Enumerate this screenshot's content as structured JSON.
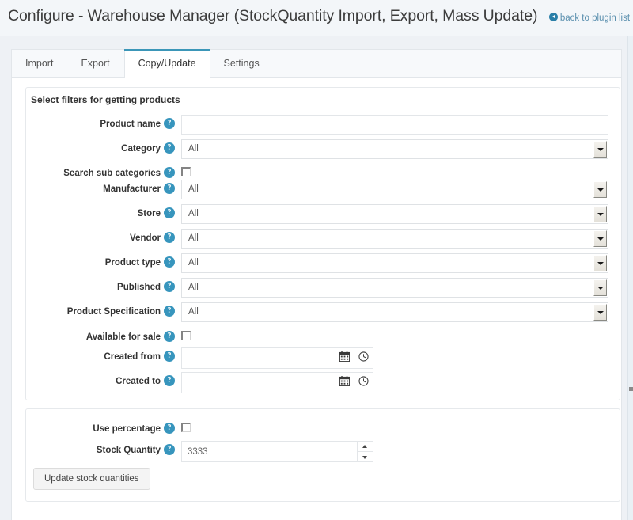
{
  "header": {
    "title": "Configure - Warehouse Manager (StockQuantity Import, Export, Mass Update)",
    "back_link": "back to plugin list",
    "back_icon": "circle-arrow-left-icon"
  },
  "tabs": [
    {
      "label": "Import",
      "active": false
    },
    {
      "label": "Export",
      "active": false
    },
    {
      "label": "Copy/Update",
      "active": true
    },
    {
      "label": "Settings",
      "active": false
    }
  ],
  "filters_panel": {
    "heading": "Select filters for getting products",
    "rows": [
      {
        "label": "Product name",
        "type": "text",
        "value": "",
        "help": "?"
      },
      {
        "label": "Category",
        "type": "select",
        "value": "All",
        "help": "?"
      },
      {
        "label": "Search sub categories",
        "type": "checkbox",
        "checked": false,
        "help": "?"
      },
      {
        "label": "Manufacturer",
        "type": "select",
        "value": "All",
        "help": "?"
      },
      {
        "label": "Store",
        "type": "select",
        "value": "All",
        "help": "?"
      },
      {
        "label": "Vendor",
        "type": "select",
        "value": "All",
        "help": "?"
      },
      {
        "label": "Product type",
        "type": "select",
        "value": "All",
        "help": "?"
      },
      {
        "label": "Published",
        "type": "select",
        "value": "All",
        "help": "?"
      },
      {
        "label": "Product Specification",
        "type": "select",
        "value": "All",
        "help": "?"
      },
      {
        "label": "Available for sale",
        "type": "checkbox",
        "checked": false,
        "help": "?"
      },
      {
        "label": "Created from",
        "type": "date",
        "value": "",
        "help": "?"
      },
      {
        "label": "Created to",
        "type": "date",
        "value": "",
        "help": "?"
      }
    ]
  },
  "stock_panel": {
    "rows": [
      {
        "label": "Use percentage",
        "type": "checkbox",
        "checked": false,
        "help": "?"
      },
      {
        "label": "Stock Quantity",
        "type": "number",
        "value": "3333",
        "help": "?"
      }
    ],
    "button_label": "Update stock quantities"
  },
  "icons": {
    "calendar": "calendar-icon",
    "clock": "clock-icon",
    "help": "help-icon"
  },
  "colors": {
    "accent": "#3795bd",
    "tab_active_border": "#3b96b8",
    "page_bg": "#eef1f5",
    "link": "#5a8fae"
  }
}
